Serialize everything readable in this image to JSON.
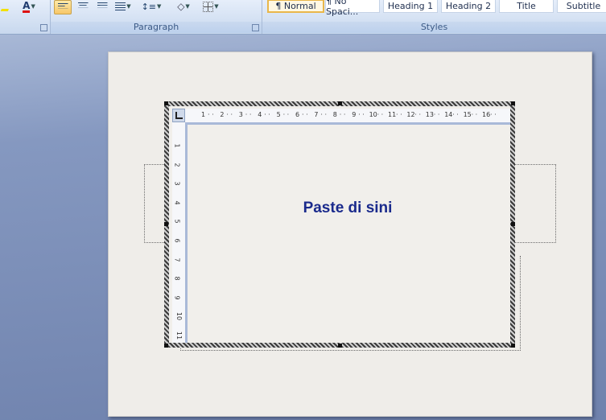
{
  "ribbon": {
    "paragraph_group_label": "Paragraph",
    "styles_group_label": "Styles",
    "styles": [
      {
        "label": "¶ Normal",
        "selected": true
      },
      {
        "label": "¶ No Spaci...",
        "selected": false
      },
      {
        "label": "Heading 1",
        "selected": false
      },
      {
        "label": "Heading 2",
        "selected": false
      },
      {
        "label": "Title",
        "selected": false
      },
      {
        "label": "Subtitle",
        "selected": false
      }
    ],
    "font_color_glyph": "A",
    "accent_color": "#f7c768"
  },
  "document": {
    "textbox_text": "Paste di sini",
    "text_color": "#1a2a8c",
    "horizontal_ruler": [
      "1",
      "2",
      "3",
      "4",
      "5",
      "6",
      "7",
      "8",
      "9",
      "10",
      "11",
      "12",
      "13",
      "14",
      "15",
      "16"
    ],
    "vertical_ruler": [
      "1",
      "2",
      "3",
      "4",
      "5",
      "6",
      "7",
      "8",
      "9",
      "10",
      "11"
    ]
  }
}
